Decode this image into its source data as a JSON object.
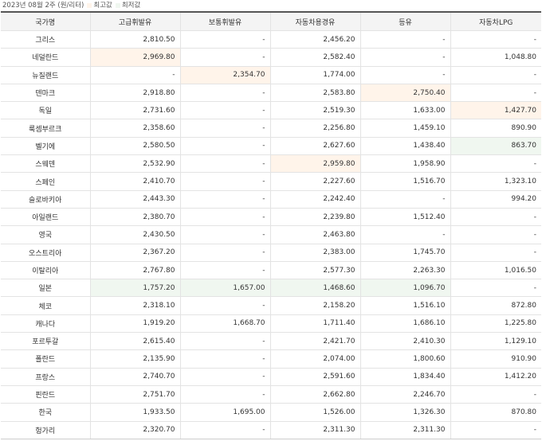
{
  "caption": {
    "period": "2023년 08월 2주 (원/리터)",
    "legend_max_label": "최고값",
    "legend_min_label": "최저값",
    "legend_max_color": "#fff4ea",
    "legend_min_color": "#f0f7f0"
  },
  "table": {
    "headers": [
      "국가명",
      "고급휘발유",
      "보통휘발유",
      "자동차용경유",
      "등유",
      "자동차LPG"
    ],
    "rows": [
      {
        "country": "그리스",
        "values": [
          "2,810.50",
          "-",
          "2,456.20",
          "-",
          "-"
        ],
        "hl": [
          "",
          "",
          "",
          "",
          ""
        ]
      },
      {
        "country": "네덜란드",
        "values": [
          "2,969.80",
          "-",
          "2,582.40",
          "-",
          "1,048.80"
        ],
        "hl": [
          "max",
          "",
          "",
          "",
          ""
        ]
      },
      {
        "country": "뉴질랜드",
        "values": [
          "-",
          "2,354.70",
          "1,774.00",
          "-",
          "-"
        ],
        "hl": [
          "",
          "max",
          "",
          "",
          ""
        ]
      },
      {
        "country": "덴마크",
        "values": [
          "2,918.80",
          "-",
          "2,583.80",
          "2,750.40",
          "-"
        ],
        "hl": [
          "",
          "",
          "",
          "max",
          ""
        ]
      },
      {
        "country": "독일",
        "values": [
          "2,731.60",
          "-",
          "2,519.30",
          "1,633.00",
          "1,427.70"
        ],
        "hl": [
          "",
          "",
          "",
          "",
          "max"
        ]
      },
      {
        "country": "룩셈부르크",
        "values": [
          "2,358.60",
          "-",
          "2,256.80",
          "1,459.10",
          "890.90"
        ],
        "hl": [
          "",
          "",
          "",
          "",
          ""
        ]
      },
      {
        "country": "벨기에",
        "values": [
          "2,580.50",
          "-",
          "2,627.60",
          "1,438.40",
          "863.70"
        ],
        "hl": [
          "",
          "",
          "",
          "",
          "min"
        ]
      },
      {
        "country": "스웨덴",
        "values": [
          "2,532.90",
          "-",
          "2,959.80",
          "1,958.90",
          "-"
        ],
        "hl": [
          "",
          "",
          "max",
          "",
          ""
        ]
      },
      {
        "country": "스페인",
        "values": [
          "2,410.70",
          "-",
          "2,227.60",
          "1,516.70",
          "1,323.10"
        ],
        "hl": [
          "",
          "",
          "",
          "",
          ""
        ]
      },
      {
        "country": "슬로바키아",
        "values": [
          "2,443.30",
          "-",
          "2,242.40",
          "-",
          "994.20"
        ],
        "hl": [
          "",
          "",
          "",
          "",
          ""
        ]
      },
      {
        "country": "아일랜드",
        "values": [
          "2,380.70",
          "-",
          "2,239.80",
          "1,512.40",
          "-"
        ],
        "hl": [
          "",
          "",
          "",
          "",
          ""
        ]
      },
      {
        "country": "영국",
        "values": [
          "2,430.50",
          "-",
          "2,463.80",
          "-",
          "-"
        ],
        "hl": [
          "",
          "",
          "",
          "",
          ""
        ]
      },
      {
        "country": "오스트리아",
        "values": [
          "2,367.20",
          "-",
          "2,383.00",
          "1,745.70",
          "-"
        ],
        "hl": [
          "",
          "",
          "",
          "",
          ""
        ]
      },
      {
        "country": "이탈리아",
        "values": [
          "2,767.80",
          "-",
          "2,577.30",
          "2,263.30",
          "1,016.50"
        ],
        "hl": [
          "",
          "",
          "",
          "",
          ""
        ]
      },
      {
        "country": "일본",
        "values": [
          "1,757.20",
          "1,657.00",
          "1,468.60",
          "1,096.70",
          "-"
        ],
        "hl": [
          "min",
          "min",
          "min",
          "min",
          ""
        ]
      },
      {
        "country": "체코",
        "values": [
          "2,318.10",
          "-",
          "2,158.20",
          "1,516.10",
          "872.80"
        ],
        "hl": [
          "",
          "",
          "",
          "",
          ""
        ]
      },
      {
        "country": "캐나다",
        "values": [
          "1,919.20",
          "1,668.70",
          "1,711.40",
          "1,686.10",
          "1,225.80"
        ],
        "hl": [
          "",
          "",
          "",
          "",
          ""
        ]
      },
      {
        "country": "포르투갈",
        "values": [
          "2,615.40",
          "-",
          "2,421.70",
          "2,410.30",
          "1,129.10"
        ],
        "hl": [
          "",
          "",
          "",
          "",
          ""
        ]
      },
      {
        "country": "폴란드",
        "values": [
          "2,135.90",
          "-",
          "2,074.00",
          "1,800.60",
          "910.90"
        ],
        "hl": [
          "",
          "",
          "",
          "",
          ""
        ]
      },
      {
        "country": "프랑스",
        "values": [
          "2,740.70",
          "-",
          "2,591.60",
          "1,834.40",
          "1,412.20"
        ],
        "hl": [
          "",
          "",
          "",
          "",
          ""
        ]
      },
      {
        "country": "핀란드",
        "values": [
          "2,751.70",
          "-",
          "2,662.80",
          "2,246.70",
          "-"
        ],
        "hl": [
          "",
          "",
          "",
          "",
          ""
        ]
      },
      {
        "country": "한국",
        "values": [
          "1,933.50",
          "1,695.00",
          "1,526.00",
          "1,326.30",
          "870.80"
        ],
        "hl": [
          "",
          "",
          "",
          "",
          ""
        ]
      },
      {
        "country": "헝가리",
        "values": [
          "2,320.70",
          "-",
          "2,311.30",
          "2,311.30",
          "-"
        ],
        "hl": [
          "",
          "",
          "",
          "",
          ""
        ]
      }
    ]
  }
}
